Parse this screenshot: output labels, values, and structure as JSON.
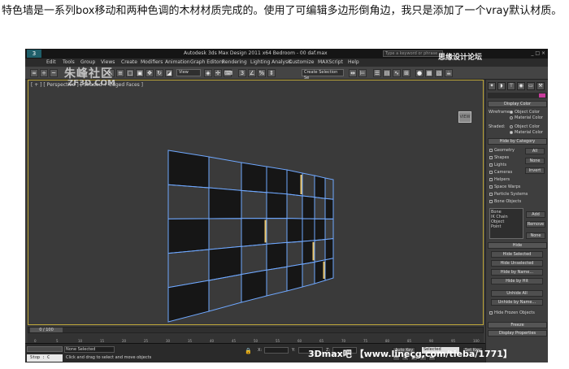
{
  "caption": "特色墙是一系列box移动和两种色调的木材材质完成的。使用了可编辑多边形倒角边，我只是添加了一个vray默认材质。",
  "app": {
    "title": "Autodesk 3ds Max Design 2011 x64   Bedroom - 00 daf.max",
    "logo": "3",
    "search_placeholder": "Type a keyword or phrase",
    "window_controls": "_ □ ×"
  },
  "menu": [
    "Edit",
    "Tools",
    "Group",
    "Views",
    "Create",
    "Modifiers",
    "Animation",
    "Graph Editors",
    "Rendering",
    "Lighting Analysis",
    "Customize",
    "MAXScript",
    "Help"
  ],
  "toolbar": {
    "view_dropdown": "View",
    "selection_set": "Create Selection Se"
  },
  "viewport": {
    "label": "[ + ] [ Perspective ] [ Shaded + Edged Faces ]",
    "viewcube": "VIEW",
    "wall_color": "#161616",
    "edge_color": "#6fa8ff",
    "wood_color": "#e8c36a"
  },
  "command_panel": {
    "display_color": {
      "header": "Display Color",
      "wireframe_label": "Wireframe:",
      "shaded_label": "Shaded:",
      "object_color": "Object Color",
      "material_color": "Material Color"
    },
    "hide_by_category": {
      "header": "Hide by Category",
      "items": [
        "Geometry",
        "Shapes",
        "Lights",
        "Cameras",
        "Helpers",
        "Space Warps",
        "Particle Systems",
        "Bone Objects"
      ],
      "all_btn": "All",
      "none_btn": "None",
      "invert_btn": "Invert",
      "list_items": [
        "Bone",
        "IK Chain Object",
        "Point"
      ],
      "add_btn": "Add",
      "remove_btn": "Remove",
      "list_none_btn": "None"
    },
    "hide": {
      "header": "Hide",
      "buttons": [
        "Hide Selected",
        "Hide Unselected",
        "Hide by Name...",
        "Hide by Hit",
        "Unhide All",
        "Unhide by Name..."
      ],
      "frozen_label": "Hide Frozen Objects"
    },
    "freeze_header": "Freeze",
    "display_props_header": "Display Properties"
  },
  "time_slider": "0 / 100",
  "track_ticks": [
    "0",
    "5",
    "10",
    "15",
    "20",
    "25",
    "30",
    "35",
    "40",
    "45",
    "50",
    "55",
    "60",
    "65",
    "70",
    "75",
    "80",
    "85",
    "90",
    "95",
    "100"
  ],
  "status": {
    "stop_text": "Stop : C",
    "selected": "None Selected",
    "prompt": "Click and drag to select and move objects",
    "x_label": "X:",
    "y_label": "Y:",
    "z_label": "Z:",
    "auto_key": "Auto Key",
    "set_key": "Set Key",
    "selected_dropdown": "Selected",
    "key_filters": "Key Filters..."
  },
  "watermarks": {
    "site_cn": "朱峰社区",
    "site_en": "ZF3D.COM",
    "corner": "思缘设计论坛",
    "bottom": "3Dmax吧 【www.linecg.com/tieba/1771】"
  }
}
